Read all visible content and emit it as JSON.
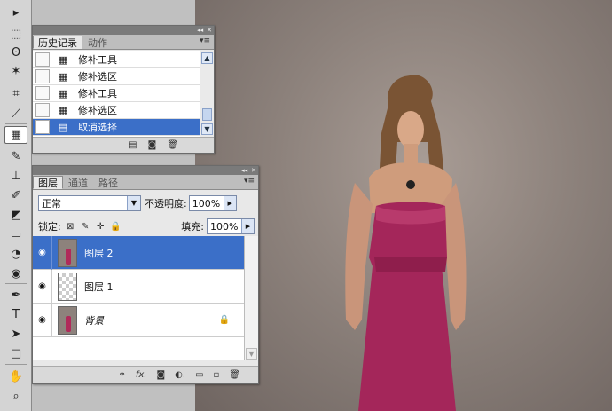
{
  "toolbox": {
    "tools": [
      {
        "icon": "move-icon",
        "glyph": "▸"
      },
      {
        "icon": "marquee-icon",
        "glyph": "⬚"
      },
      {
        "icon": "lasso-icon",
        "glyph": "ʘ"
      },
      {
        "icon": "magic-wand-icon",
        "glyph": "✶"
      },
      {
        "icon": "crop-icon",
        "glyph": "⌗"
      },
      {
        "icon": "eyedropper-icon",
        "glyph": "⟋"
      },
      {
        "icon": "patch-icon",
        "glyph": "▦"
      },
      {
        "icon": "brush-icon",
        "glyph": "✎"
      },
      {
        "icon": "stamp-icon",
        "glyph": "⊥"
      },
      {
        "icon": "history-brush-icon",
        "glyph": "✐"
      },
      {
        "icon": "eraser-icon",
        "glyph": "◩"
      },
      {
        "icon": "gradient-icon",
        "glyph": "▭"
      },
      {
        "icon": "blur-icon",
        "glyph": "◔"
      },
      {
        "icon": "dodge-icon",
        "glyph": "◉"
      },
      {
        "icon": "pen-icon",
        "glyph": "✒"
      },
      {
        "icon": "type-icon",
        "glyph": "T"
      },
      {
        "icon": "path-select-icon",
        "glyph": "➤"
      },
      {
        "icon": "shape-icon",
        "glyph": "□"
      },
      {
        "icon": "hand-icon",
        "glyph": "✋"
      },
      {
        "icon": "zoom-icon",
        "glyph": "⌕"
      }
    ]
  },
  "history": {
    "tabs": [
      "历史记录",
      "动作"
    ],
    "items": [
      {
        "label": "修补工具",
        "selected": false
      },
      {
        "label": "修补选区",
        "selected": false
      },
      {
        "label": "修补工具",
        "selected": false
      },
      {
        "label": "修补选区",
        "selected": false
      },
      {
        "label": "取消选择",
        "selected": true
      }
    ]
  },
  "layers": {
    "tabs": [
      "图层",
      "通道",
      "路径"
    ],
    "blend_mode": "正常",
    "opacity_label": "不透明度:",
    "opacity_value": "100%",
    "lock_label": "锁定:",
    "fill_label": "填充:",
    "fill_value": "100%",
    "items": [
      {
        "name": "图层 2",
        "selected": true,
        "thumb": "photo"
      },
      {
        "name": "图层 1",
        "selected": false,
        "thumb": "checker"
      },
      {
        "name": "背景",
        "selected": false,
        "thumb": "photo",
        "locked": true
      }
    ],
    "footer_icons": [
      "link-icon",
      "fx-icon",
      "mask-icon",
      "adjustment-icon",
      "group-icon",
      "new-layer-icon",
      "trash-icon"
    ],
    "footer_glyphs": [
      "⚭",
      "fx.",
      "◙",
      "◐.",
      "▭",
      "▫",
      "🗑"
    ]
  },
  "colors": {
    "selection_blue": "#3b6fc8",
    "dress": "#a4265a",
    "backdrop": "#8d827c"
  }
}
